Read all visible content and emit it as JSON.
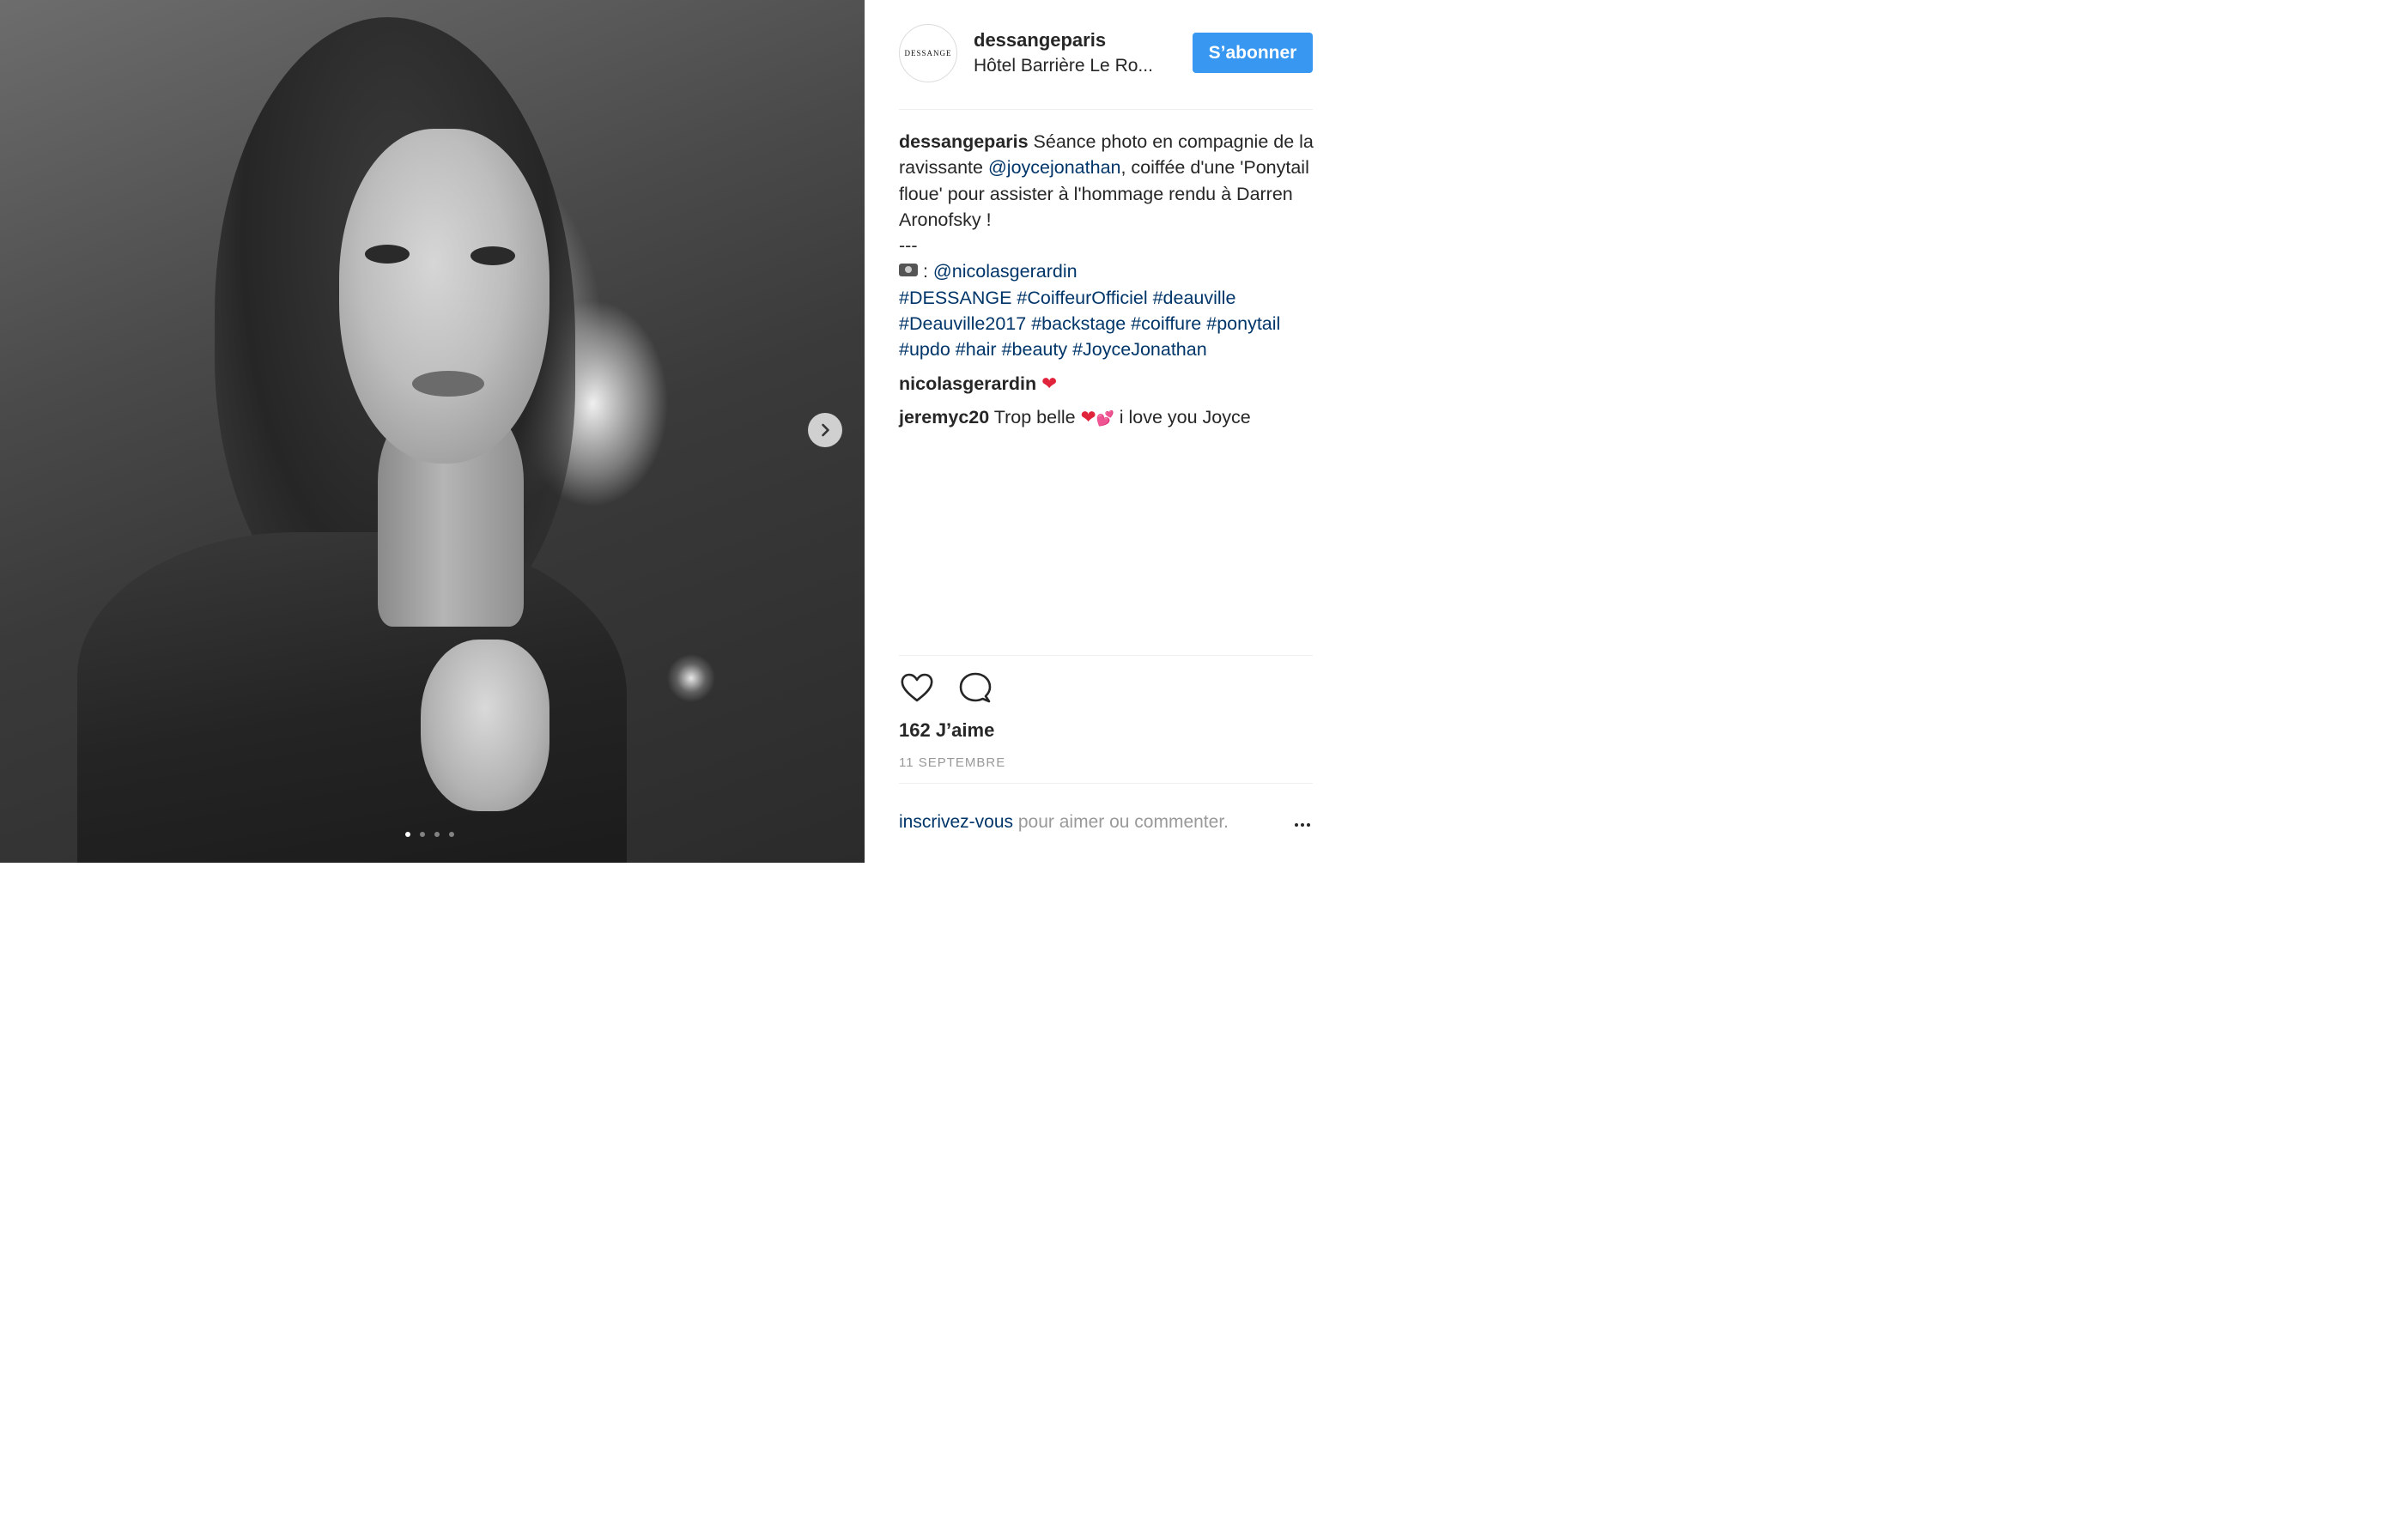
{
  "post": {
    "image": {
      "description": ""
    },
    "carousel": {
      "total": 4,
      "active": 1
    }
  },
  "header": {
    "username": "dessangeparis",
    "location": "Hôtel Barrière Le Ro...",
    "avatar_text": "DESSANGE",
    "follow_label": "S’abonner"
  },
  "caption": {
    "username": "dessangeparis",
    "text_1": " Séance photo en compagnie de la ravissante ",
    "mention_1": "@joycejonathan",
    "text_2": ", coiffée d'une 'Ponytail floue' pour assister à l'hommage rendu à Darren Aronofsky !",
    "separator": "---",
    "camera_sep": " : ",
    "mention_2": "@nicolasgerardin",
    "hashtags": [
      "#DESSANGE",
      "#CoiffeurOfficiel",
      "#deauville",
      "#Deauville2017",
      "#backstage",
      "#coiffure",
      "#ponytail",
      "#updo",
      "#hair",
      "#beauty",
      "#JoyceJonathan"
    ]
  },
  "comments": [
    {
      "username": "nicolasgerardin",
      "text": " ",
      "emoji": "❤"
    },
    {
      "username": "jeremyc20",
      "text_before": " Trop belle ",
      "emoji1": "❤",
      "emoji2": "💕",
      "text_after": " i love you Joyce"
    }
  ],
  "stats": {
    "likes": "162 J’aime",
    "date": "11 SEPTEMBRE"
  },
  "footer": {
    "signup_link": "inscrivez-vous",
    "signup_text": " pour aimer ou commenter."
  },
  "colors": {
    "accent": "#3897f0",
    "link": "#003569",
    "muted": "#999999",
    "text": "#262626"
  },
  "icons": [
    "chevron-right-icon",
    "heart-icon",
    "comment-icon",
    "more-icon",
    "camera-emoji-icon"
  ]
}
